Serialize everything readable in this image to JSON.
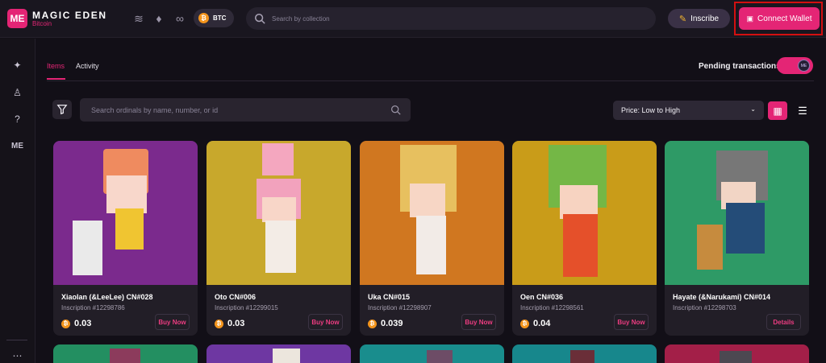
{
  "brand": {
    "name": "MAGIC EDEN",
    "subtitle": "Bitcoin",
    "logo_text": "ME"
  },
  "topbar": {
    "chain_icons": [
      "solana-icon",
      "ethereum-icon",
      "polygon-icon"
    ],
    "chain_selector": {
      "label": "BTC",
      "coin_symbol": "₿"
    },
    "search": {
      "placeholder": "Search by collection"
    },
    "inscribe_label": "Inscribe",
    "connect_label": "Connect Wallet",
    "accent": "#e42575",
    "highlight_color": "#d31010"
  },
  "sidebar": {
    "icons": [
      "launchpad-icon",
      "rewards-icon",
      "help-icon",
      "me-icon",
      "more-icon"
    ]
  },
  "main": {
    "tabs": [
      {
        "label": "Items",
        "active": true
      },
      {
        "label": "Activity",
        "active": false
      }
    ],
    "pending_label": "Pending transactions",
    "pending_enabled": true,
    "toggle_knob_label": "ME",
    "search_placeholder": "Search ordinals by name, number, or id",
    "sort_value": "Price: Low to High",
    "view_mode": "grid"
  },
  "cards": [
    {
      "name": "Xiaolan (&LeeLee) CN#028",
      "inscription": "Inscription #12298786",
      "price": "0.03",
      "button": "Buy Now",
      "background": "#7b2a8d"
    },
    {
      "name": "Oto CN#006",
      "inscription": "Inscription #12299015",
      "price": "0.03",
      "button": "Buy Now",
      "background": "#c8a82c"
    },
    {
      "name": "Uka CN#015",
      "inscription": "Inscription #12298907",
      "price": "0.039",
      "button": "Buy Now",
      "background": "#d07720"
    },
    {
      "name": "Oen CN#036",
      "inscription": "Inscription #12298561",
      "price": "0.04",
      "button": "Buy Now",
      "background": "#c99c19"
    },
    {
      "name": "Hayate (&Narukami) CN#014",
      "inscription": "Inscription #12298703",
      "price": "",
      "button": "Details",
      "background": "#2e9a66"
    }
  ],
  "next_row_backgrounds": [
    "#238f61",
    "#6e37a2",
    "#198d8d",
    "#17878c",
    "#a31f48"
  ]
}
